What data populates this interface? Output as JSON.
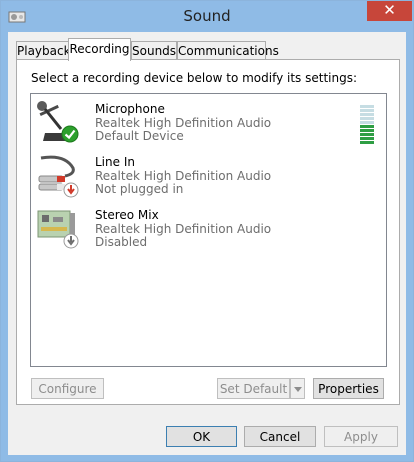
{
  "window": {
    "title": "Sound",
    "close_glyph": "✕"
  },
  "tabs": [
    {
      "label": "Playback",
      "active": false
    },
    {
      "label": "Recording",
      "active": true
    },
    {
      "label": "Sounds",
      "active": false
    },
    {
      "label": "Communications",
      "active": false
    }
  ],
  "panel": {
    "instruction": "Select a recording device below to modify its settings:"
  },
  "devices": [
    {
      "name": "Microphone",
      "driver": "Realtek High Definition Audio",
      "status": "Default Device",
      "icon": "microphone-icon",
      "badge": "green-check"
    },
    {
      "name": "Line In",
      "driver": "Realtek High Definition Audio",
      "status": "Not plugged in",
      "icon": "line-in-icon",
      "badge": "red-down-arrow"
    },
    {
      "name": "Stereo Mix",
      "driver": "Realtek High Definition Audio",
      "status": "Disabled",
      "icon": "sound-card-icon",
      "badge": "gray-down-arrow"
    }
  ],
  "meter": {
    "bars_total": 10,
    "bars_lit": 5,
    "lit_color": "#2e9e44",
    "unlit_color": "#c6dde3"
  },
  "panel_buttons": {
    "configure": "Configure",
    "set_default": "Set Default",
    "properties": "Properties"
  },
  "dialog_buttons": {
    "ok": "OK",
    "cancel": "Cancel",
    "apply": "Apply"
  },
  "colors": {
    "titlebar": "#8fbbe6",
    "close": "#c7463a",
    "check": "#2ca02c",
    "unplugged": "#d03a2a"
  }
}
